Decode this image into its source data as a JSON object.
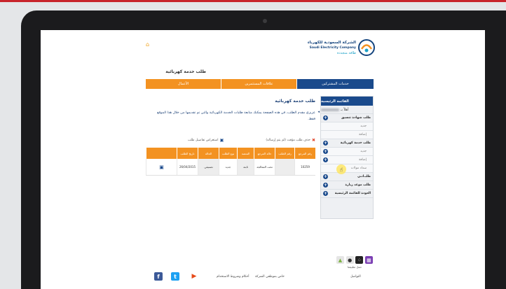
{
  "company": {
    "name_ar": "الشركة السعودية للكهرباء",
    "name_en": "Saudi Electricity Company",
    "slogan": "طاقة متجددة"
  },
  "page_title": "طلب خدمة كهربائية",
  "nav": {
    "tabs": [
      {
        "label": "خدمات المشتركين"
      },
      {
        "label": "علاقات المستثمرين"
      },
      {
        "label": "الأعمال"
      }
    ]
  },
  "sidebar": {
    "title": "القائمة الرئيسية",
    "greeting": "أهلاً بـ",
    "items": [
      {
        "label": "طلب شهادة تنسيق",
        "type": "group"
      },
      {
        "label": "جديد",
        "type": "sub"
      },
      {
        "label": "إضافة",
        "type": "sub"
      },
      {
        "label": "طلب خدمة كهربائية",
        "type": "group"
      },
      {
        "label": "جديد",
        "type": "sub"
      },
      {
        "label": "إضافة",
        "type": "sub"
      },
      {
        "label": "سداد مولات",
        "type": "sub"
      },
      {
        "label": "طلبـاتـي",
        "type": "group"
      },
      {
        "label": "طلب موعد زيارة",
        "type": "group"
      },
      {
        "label": "العودة للقائمة الرئيسية",
        "type": "group"
      }
    ]
  },
  "content": {
    "title": "طلب خدمة كهربائية",
    "description": "عزيزي مقدم الطلب، في هذه الصفحة يمكنك متابعة طلبات الخدمة الكهربائية والتي تم تقديمها من خلال هذا الموقع فقط.",
    "actions": {
      "delete": "حذف طلب مؤقت (لم يتم إرساله)",
      "view": "استعراض تفاصيل طلب"
    },
    "table": {
      "headers": [
        "رقم المرجع",
        "رقم الطلب",
        "حالة المرجع",
        "المنصة",
        "نوع الطلب",
        "الحالة",
        "تاريخ الطلب",
        ""
      ],
      "rows": [
        [
          "10259",
          "",
          "تحت المعالجة",
          "",
          "جديد",
          "تصنيفي",
          "26/04/2015",
          ""
        ]
      ]
    }
  },
  "apps": {
    "label": "حمل تطبيقنا"
  },
  "footer": {
    "contact": "التواصل",
    "privacy": "خاص بموظفي الشركة",
    "terms": "أحكام وشروط الاستخدام"
  },
  "colors": {
    "primary_blue": "#1a4a8c",
    "accent_orange": "#f39221"
  }
}
